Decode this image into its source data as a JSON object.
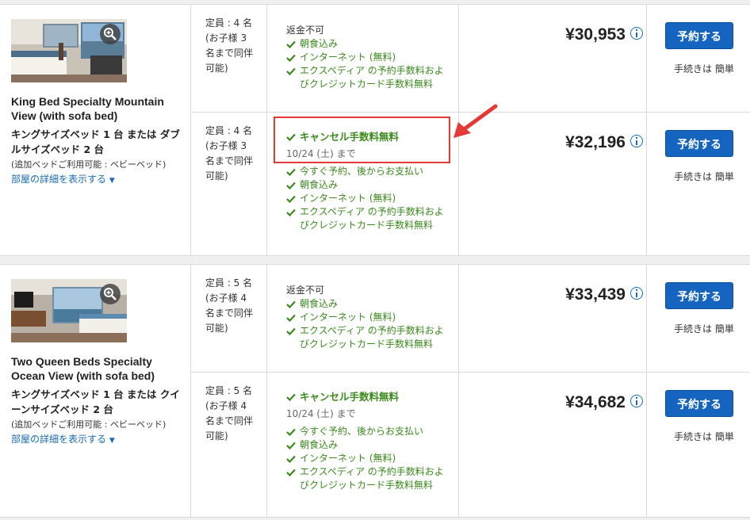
{
  "rooms": [
    {
      "name": "King Bed Specialty Mountain View (with sofa bed)",
      "bed": "キングサイズベッド 1 台 または ダブルサイズベッド 2 台",
      "extra_bed": "(追加ベッドご利用可能 : ベビーベッド)",
      "details_link": "部屋の詳細を表示する",
      "rates": [
        {
          "occupancy": "定員 : 4 名 (お子様 3 名まで同伴可能)",
          "refund": "返金不可",
          "cancel_label": "",
          "cancel_until": "",
          "features": [
            "朝食込み",
            "インターネット (無料)",
            "エクスペディア の予約手数料およびクレジットカード手数料無料"
          ],
          "price": "¥30,953",
          "book_label": "予約する",
          "easy_label": "手続きは 簡単"
        },
        {
          "occupancy": "定員 : 4 名 (お子様 3 名まで同伴可能)",
          "refund": "",
          "cancel_label": "キャンセル手数料無料",
          "cancel_until": "10/24 (土) まで",
          "features": [
            "今すぐ予約、後からお支払い",
            "朝食込み",
            "インターネット (無料)",
            "エクスペディア の予約手数料およびクレジットカード手数料無料"
          ],
          "price": "¥32,196",
          "book_label": "予約する",
          "easy_label": "手続きは 簡単"
        }
      ]
    },
    {
      "name": "Two Queen Beds Specialty Ocean View (with sofa bed)",
      "bed": "キングサイズベッド 1 台 または クイーンサイズベッド 2 台",
      "extra_bed": "(追加ベッドご利用可能 : ベビーベッド)",
      "details_link": "部屋の詳細を表示する",
      "rates": [
        {
          "occupancy": "定員 : 5 名 (お子様 4 名まで同伴可能)",
          "refund": "返金不可",
          "cancel_label": "",
          "cancel_until": "",
          "features": [
            "朝食込み",
            "インターネット (無料)",
            "エクスペディア の予約手数料およびクレジットカード手数料無料"
          ],
          "price": "¥33,439",
          "book_label": "予約する",
          "easy_label": "手続きは 簡単"
        },
        {
          "occupancy": "定員 : 5 名 (お子様 4 名まで同伴可能)",
          "refund": "",
          "cancel_label": "キャンセル手数料無料",
          "cancel_until": "10/24 (土) まで",
          "features": [
            "今すぐ予約、後からお支払い",
            "朝食込み",
            "インターネット (無料)",
            "エクスペディア の予約手数料およびクレジットカード手数料無料"
          ],
          "price": "¥34,682",
          "book_label": "予約する",
          "easy_label": "手続きは 簡単"
        }
      ]
    }
  ],
  "colors": {
    "accent_blue": "#1565c0",
    "link_blue": "#1a6bb5",
    "green": "#3a8a1c",
    "highlight_red": "#e53935"
  },
  "icons": {
    "zoom": "magnifier-plus-icon",
    "check": "checkmark-icon",
    "info": "info-icon",
    "expand": "double-chevron-down-icon"
  }
}
